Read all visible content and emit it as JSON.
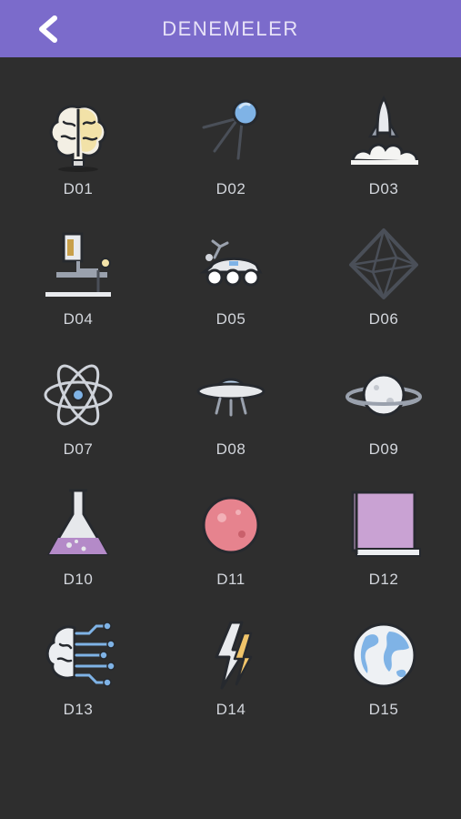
{
  "header": {
    "title": "DENEMELER",
    "back_icon": "chevron-left-icon",
    "background": "#7b6bcb"
  },
  "tests": [
    {
      "label": "D01",
      "icon": "brain-icon"
    },
    {
      "label": "D02",
      "icon": "satellite-icon"
    },
    {
      "label": "D03",
      "icon": "rocket-launch-icon"
    },
    {
      "label": "D04",
      "icon": "microscope-icon"
    },
    {
      "label": "D05",
      "icon": "lunar-rover-icon"
    },
    {
      "label": "D06",
      "icon": "octahedron-icon"
    },
    {
      "label": "D07",
      "icon": "atom-icon"
    },
    {
      "label": "D08",
      "icon": "ufo-icon"
    },
    {
      "label": "D09",
      "icon": "ringed-planet-icon"
    },
    {
      "label": "D10",
      "icon": "flask-icon"
    },
    {
      "label": "D11",
      "icon": "red-planet-icon"
    },
    {
      "label": "D12",
      "icon": "book-icon"
    },
    {
      "label": "D13",
      "icon": "ai-brain-circuit-icon"
    },
    {
      "label": "D14",
      "icon": "lightning-icon"
    },
    {
      "label": "D15",
      "icon": "earth-globe-icon"
    }
  ]
}
